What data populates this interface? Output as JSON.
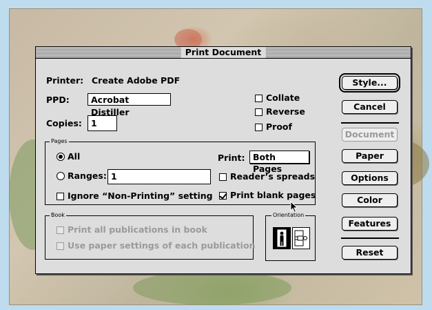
{
  "dialog": {
    "title": "Print Document"
  },
  "printer": {
    "label": "Printer:",
    "value": "Create Adobe PDF"
  },
  "ppd": {
    "label": "PPD:",
    "value": "Acrobat Distiller"
  },
  "copies": {
    "label": "Copies:",
    "value": "1"
  },
  "options": {
    "collate": {
      "label": "Collate",
      "checked": false
    },
    "reverse": {
      "label": "Reverse",
      "checked": false
    },
    "proof": {
      "label": "Proof",
      "checked": false
    }
  },
  "pages": {
    "group_label": "Pages",
    "all_label": "All",
    "all_selected": true,
    "ranges_label": "Ranges:",
    "ranges_value": "1",
    "ignore_label": "Ignore “Non-Printing” setting",
    "print_label": "Print:",
    "print_value": "Both Pages",
    "readers_spreads_label": "Reader’s spreads",
    "print_blank_label": "Print blank pages",
    "print_blank_checked": true
  },
  "book": {
    "group_label": "Book",
    "print_all_label": "Print all publications in book",
    "use_paper_label": "Use paper settings of each publication"
  },
  "orientation": {
    "group_label": "Orientation",
    "icons": [
      "portrait-icon",
      "landscape-icon"
    ],
    "selected": "portrait"
  },
  "buttons": {
    "style": "Style...",
    "cancel": "Cancel",
    "document": "Document",
    "paper": "Paper",
    "options": "Options",
    "color": "Color",
    "features": "Features",
    "reset": "Reset"
  },
  "colors": {
    "dialog_bg": "#dddddd",
    "disabled_text": "#9a9a9a"
  }
}
